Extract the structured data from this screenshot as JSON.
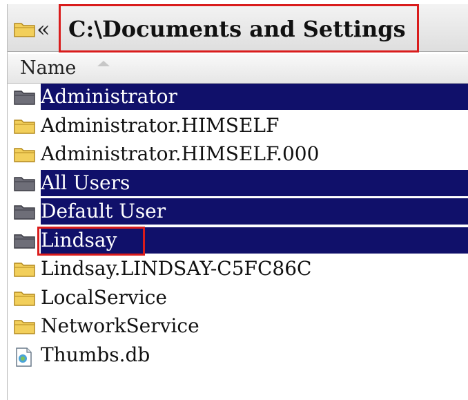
{
  "address_bar": {
    "breadcrumb_arrow": "«",
    "path": "C:\\Documents and Settings",
    "icon": "folder-icon"
  },
  "column_header": {
    "name": "Name",
    "sort_indicator": "sort-ascending-icon"
  },
  "files": [
    {
      "name": "Administrator",
      "type": "folder",
      "selected": true
    },
    {
      "name": "Administrator.HIMSELF",
      "type": "folder",
      "selected": false
    },
    {
      "name": "Administrator.HIMSELF.000",
      "type": "folder",
      "selected": false
    },
    {
      "name": "All Users",
      "type": "folder",
      "selected": true
    },
    {
      "name": "Default User",
      "type": "folder",
      "selected": true
    },
    {
      "name": "Lindsay",
      "type": "folder",
      "selected": true
    },
    {
      "name": "Lindsay.LINDSAY-C5FC86C",
      "type": "folder",
      "selected": false
    },
    {
      "name": "LocalService",
      "type": "folder",
      "selected": false
    },
    {
      "name": "NetworkService",
      "type": "folder",
      "selected": false
    },
    {
      "name": "Thumbs.db",
      "type": "file",
      "selected": false
    }
  ],
  "colors": {
    "selection": "#10106a",
    "highlight_box": "#d91c1c",
    "folder_yellow": "#f2cf5b",
    "folder_gray": "#6e6e78"
  }
}
